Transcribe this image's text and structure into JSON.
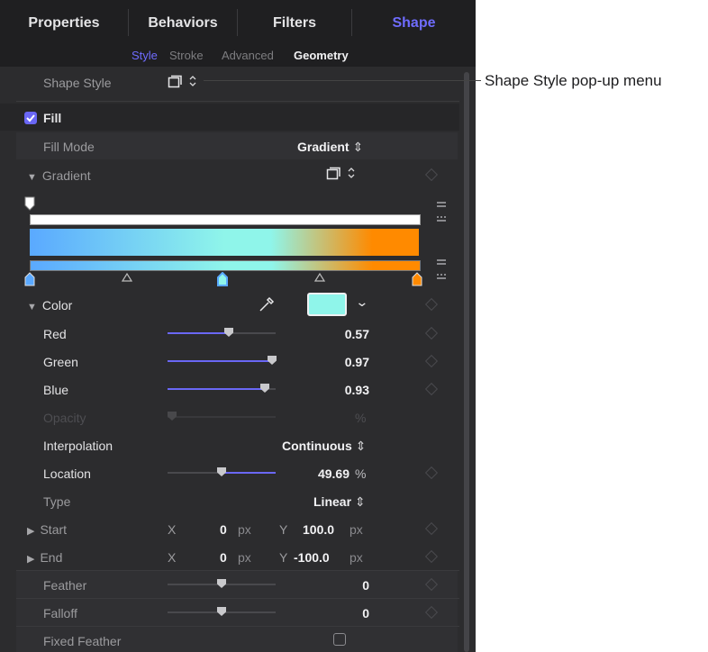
{
  "tabs": [
    "Properties",
    "Behaviors",
    "Filters",
    "Shape"
  ],
  "subtabs": [
    "Style",
    "Stroke",
    "Advanced",
    "Geometry"
  ],
  "shape_style": {
    "label": "Shape Style"
  },
  "fill": {
    "label": "Fill",
    "checked": true
  },
  "fill_mode": {
    "label": "Fill Mode",
    "value": "Gradient"
  },
  "gradient": {
    "label": "Gradient",
    "colors": [
      "#5aa9ff",
      "#8ff5ea",
      "#ff8a00"
    ]
  },
  "color": {
    "label": "Color",
    "swatch": "#8ff5ea"
  },
  "red": {
    "label": "Red",
    "value": "0.57",
    "level": 0.57
  },
  "green": {
    "label": "Green",
    "value": "0.97",
    "level": 0.97
  },
  "blue": {
    "label": "Blue",
    "value": "0.93",
    "level": 0.93
  },
  "opacity": {
    "label": "Opacity",
    "unit": "%"
  },
  "interpolation": {
    "label": "Interpolation",
    "value": "Continuous"
  },
  "location": {
    "label": "Location",
    "value": "49.69",
    "unit": "%",
    "level": 0.4969
  },
  "type": {
    "label": "Type",
    "value": "Linear"
  },
  "start": {
    "label": "Start",
    "x_label": "X",
    "x": "0",
    "x_unit": "px",
    "y_label": "Y",
    "y": "100.0",
    "y_unit": "px"
  },
  "end": {
    "label": "End",
    "x_label": "X",
    "x": "0",
    "x_unit": "px",
    "y_label": "Y",
    "y": "-100.0",
    "y_unit": "px"
  },
  "feather": {
    "label": "Feather",
    "value": "0"
  },
  "falloff": {
    "label": "Falloff",
    "value": "0"
  },
  "fixed_feather": {
    "label": "Fixed Feather"
  },
  "callout": "Shape Style pop-up menu",
  "accent": "#6f6cff"
}
